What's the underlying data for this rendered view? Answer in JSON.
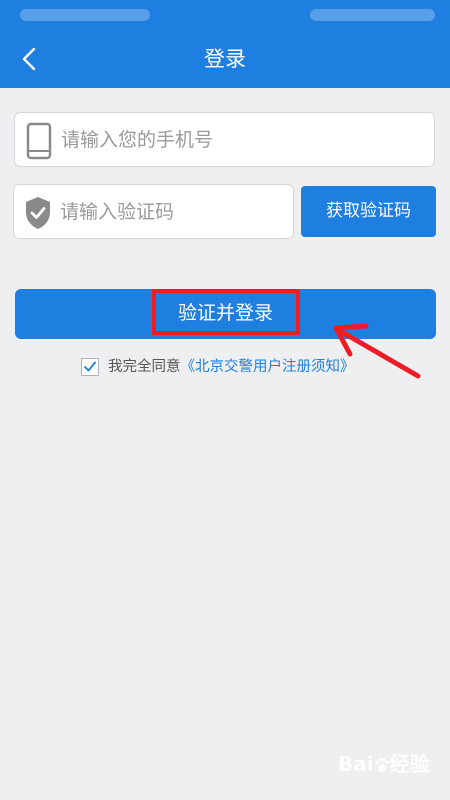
{
  "header": {
    "title": "登录",
    "back_icon": "chevron-left-icon"
  },
  "phone_field": {
    "icon": "phone-icon",
    "placeholder": "请输入您的手机号",
    "value": ""
  },
  "code_field": {
    "icon": "shield-check-icon",
    "placeholder": "请输入验证码",
    "value": ""
  },
  "get_code_button": {
    "label": "获取验证码"
  },
  "login_button": {
    "label": "验证并登录"
  },
  "agreement": {
    "checked": true,
    "prefix": "我完全同意",
    "link": "《北京交警用户注册须知》"
  },
  "watermark": {
    "text_left": "Bai",
    "text_right": "经验"
  },
  "colors": {
    "primary": "#1f7fe0",
    "background": "#eeeff1",
    "annotation": "#ee1c24"
  }
}
